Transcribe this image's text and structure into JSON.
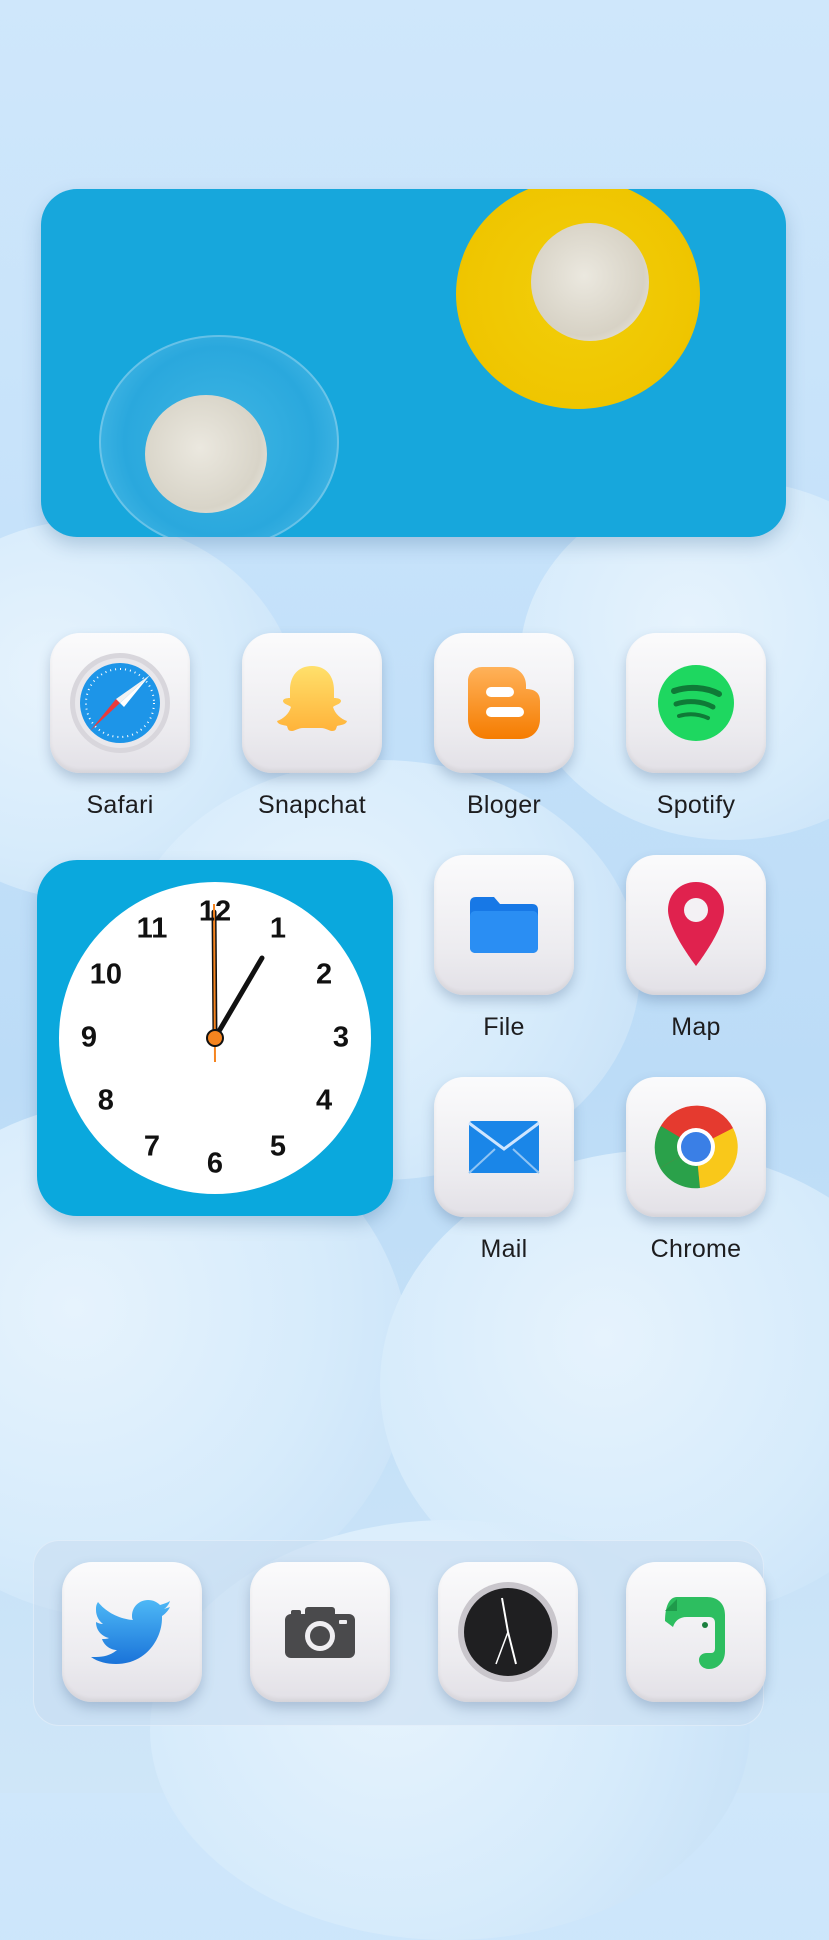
{
  "home": {
    "apps": [
      {
        "label": "Safari",
        "icon": "safari-icon"
      },
      {
        "label": "Snapchat",
        "icon": "snapchat-icon"
      },
      {
        "label": "Bloger",
        "icon": "blogger-icon"
      },
      {
        "label": "Spotify",
        "icon": "spotify-icon"
      },
      {
        "label": "File",
        "icon": "folder-icon"
      },
      {
        "label": "Map",
        "icon": "map-pin-icon"
      },
      {
        "label": "Mail",
        "icon": "mail-icon"
      },
      {
        "label": "Chrome",
        "icon": "chrome-icon"
      }
    ]
  },
  "clock_widget": {
    "numbers": [
      "12",
      "1",
      "2",
      "3",
      "4",
      "5",
      "6",
      "7",
      "8",
      "9",
      "10",
      "11"
    ],
    "time": "1:00"
  },
  "dock": {
    "apps": [
      {
        "icon": "twitter-icon"
      },
      {
        "icon": "camera-icon"
      },
      {
        "icon": "clock-icon"
      },
      {
        "icon": "evernote-icon"
      }
    ]
  },
  "colors": {
    "background": "#c6e2fa",
    "widget_blue": "#0aa8dd",
    "accent_orange": "#f5841f"
  }
}
